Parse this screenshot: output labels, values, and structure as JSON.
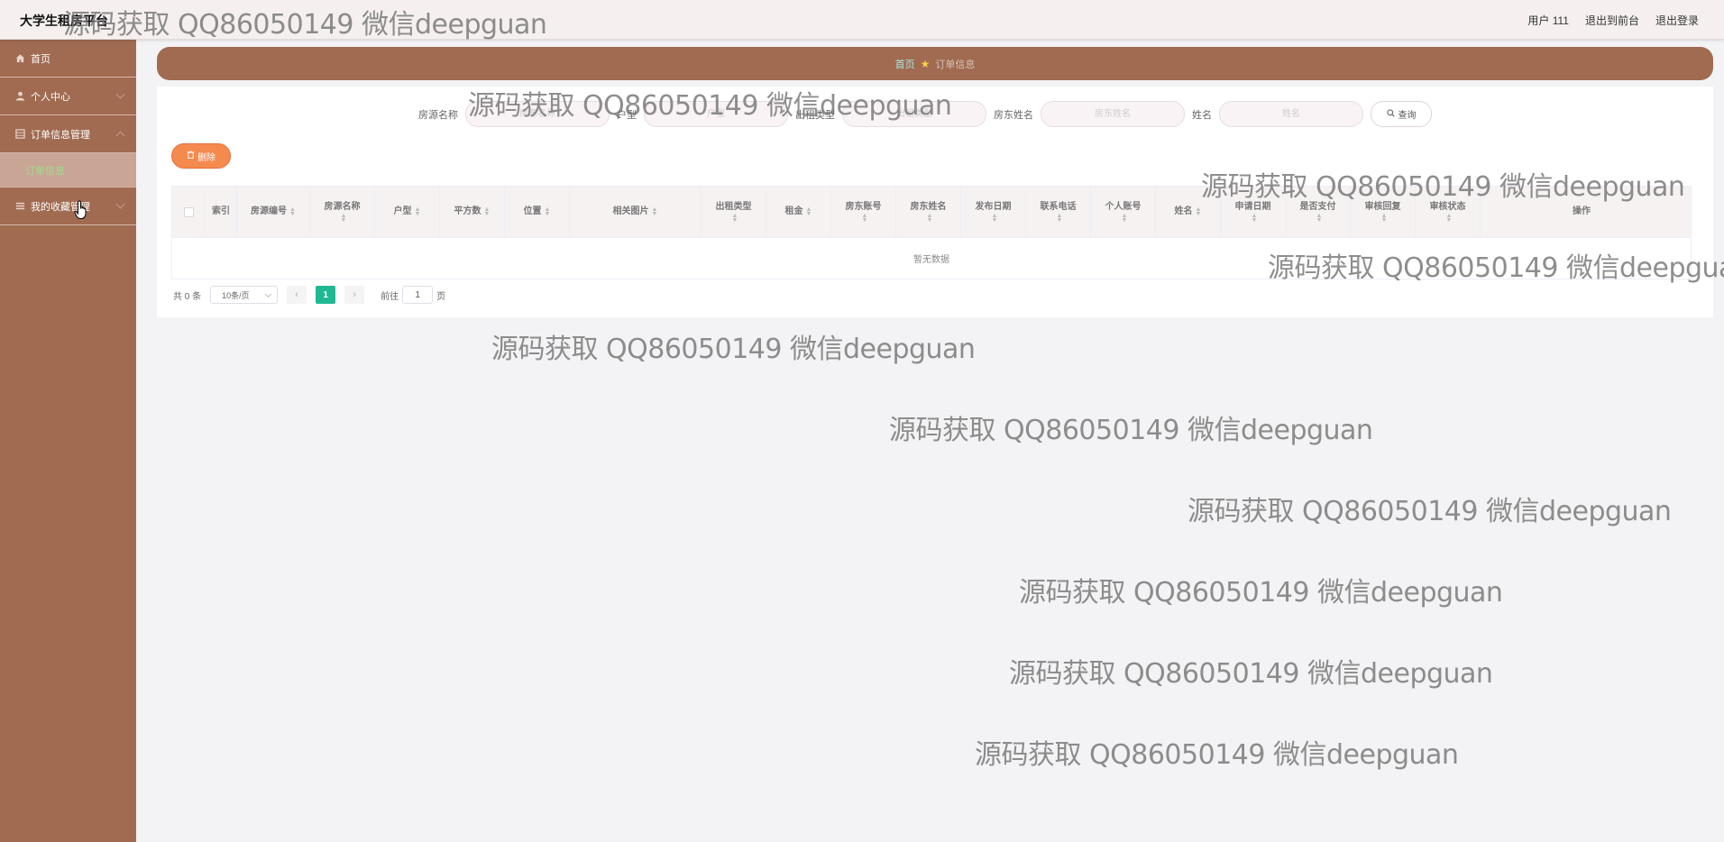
{
  "header": {
    "brand": "大学生租房平台",
    "user": "用户 111",
    "to_front": "退出到前台",
    "logout": "退出登录"
  },
  "sidebar": {
    "items": [
      {
        "label": "首页",
        "icon": "home-icon"
      },
      {
        "label": "个人中心",
        "icon": "user-icon"
      },
      {
        "label": "订单信息管理",
        "icon": "table-icon"
      },
      {
        "label": "订单信息",
        "sub": true
      },
      {
        "label": "我的收藏管理",
        "icon": "menu-icon"
      }
    ]
  },
  "breadcrumb": {
    "home": "首页",
    "current": "订单信息"
  },
  "search": {
    "fields": [
      {
        "label": "房源名称",
        "placeholder": "房源名称"
      },
      {
        "label": "户型",
        "placeholder": "户型"
      },
      {
        "label": "出租类型",
        "placeholder": "出租类型"
      },
      {
        "label": "房东姓名",
        "placeholder": "房东姓名"
      },
      {
        "label": "姓名",
        "placeholder": "姓名"
      }
    ],
    "query_label": "查询"
  },
  "actions": {
    "delete_label": "删除"
  },
  "table": {
    "columns": [
      "索引",
      "房源编号",
      "房源名称",
      "户型",
      "平方数",
      "位置",
      "相关图片",
      "出租类型",
      "租金",
      "房东账号",
      "房东姓名",
      "发布日期",
      "联系电话",
      "个人账号",
      "姓名",
      "申请日期",
      "是否支付",
      "审核回复",
      "审核状态",
      "操作"
    ],
    "empty_text": "暂无数据"
  },
  "pagination": {
    "total": "共 0 条",
    "page_size": "10条/页",
    "current_page": "1",
    "goto_prefix": "前往",
    "goto_value": "1",
    "goto_suffix": "页"
  },
  "watermark": "源码获取 QQ86050149 微信deepguan",
  "colors": {
    "sidebar": "#a06b51",
    "accent_orange": "#f58a4f",
    "page_active": "#20b893"
  }
}
